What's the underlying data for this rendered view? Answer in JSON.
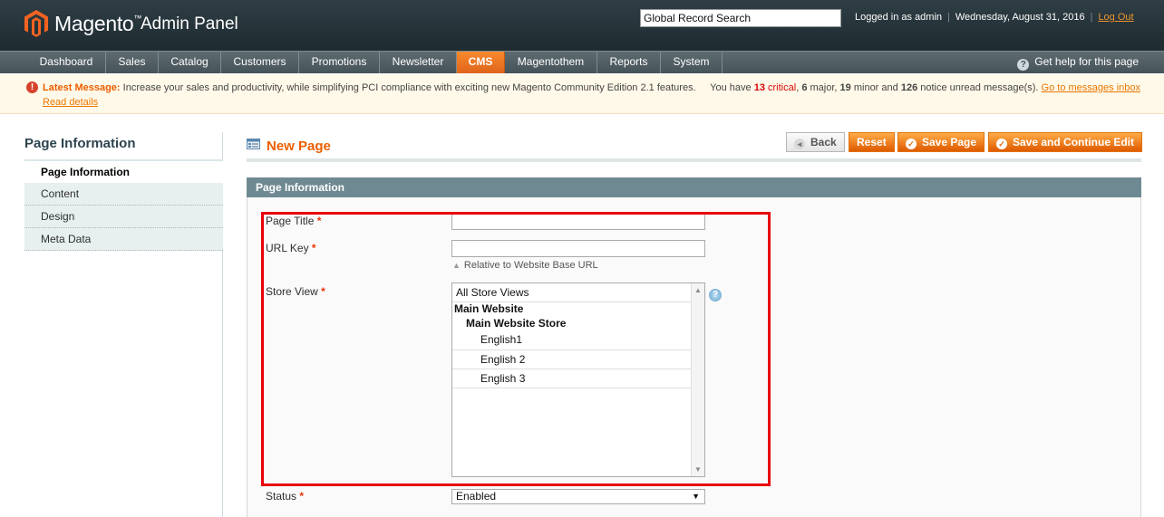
{
  "header": {
    "logo_name": "Magento",
    "logo_tm": "™",
    "logo_sub": "Admin Panel",
    "search_value": "Global Record Search",
    "logged_in": "Logged in as admin",
    "date": "Wednesday, August 31, 2016",
    "logout": "Log Out"
  },
  "nav": {
    "items": [
      "Dashboard",
      "Sales",
      "Catalog",
      "Customers",
      "Promotions",
      "Newsletter",
      "CMS",
      "Magentothem",
      "Reports",
      "System"
    ],
    "active": "CMS",
    "help": "Get help for this page"
  },
  "message": {
    "label": "Latest Message:",
    "text": "Increase your sales and productivity, while simplifying PCI compliance with exciting new Magento Community Edition 2.1 features.",
    "you_have": "You have",
    "critical_count": "13",
    "critical_label": "critical",
    "major_count": "6",
    "major_label": "major",
    "minor_count": "19",
    "minor_label": "minor",
    "notice_count": "126",
    "notice_label": "notice unread message(s).",
    "inbox_link": "Go to messages inbox",
    "read_details": "Read details"
  },
  "sidebar": {
    "title": "Page Information",
    "tabs": [
      "Page Information",
      "Content",
      "Design",
      "Meta Data"
    ]
  },
  "page": {
    "heading": "New Page",
    "buttons": {
      "back": "Back",
      "reset": "Reset",
      "save": "Save Page",
      "save_continue": "Save and Continue Edit"
    }
  },
  "form": {
    "section_title": "Page Information",
    "page_title_label": "Page Title",
    "page_title_value": "",
    "url_key_label": "URL Key",
    "url_key_value": "",
    "url_key_note": "Relative to Website Base URL",
    "store_view_label": "Store View",
    "store_view_options": {
      "all": "All Store Views",
      "website": "Main Website",
      "store": "Main Website Store",
      "views": [
        "English1",
        "English 2",
        "English 3"
      ]
    },
    "status_label": "Status",
    "status_value": "Enabled",
    "required_mark": "*"
  },
  "colors": {
    "accent_orange": "#eb5e00",
    "nav_active": "#f0782a",
    "highlight_red": "#e8000b",
    "section_head": "#6f8992"
  },
  "icons": [
    "magento-logo-icon",
    "help-icon",
    "error-icon",
    "page-icon",
    "back-icon",
    "check-icon",
    "info-icon"
  ]
}
